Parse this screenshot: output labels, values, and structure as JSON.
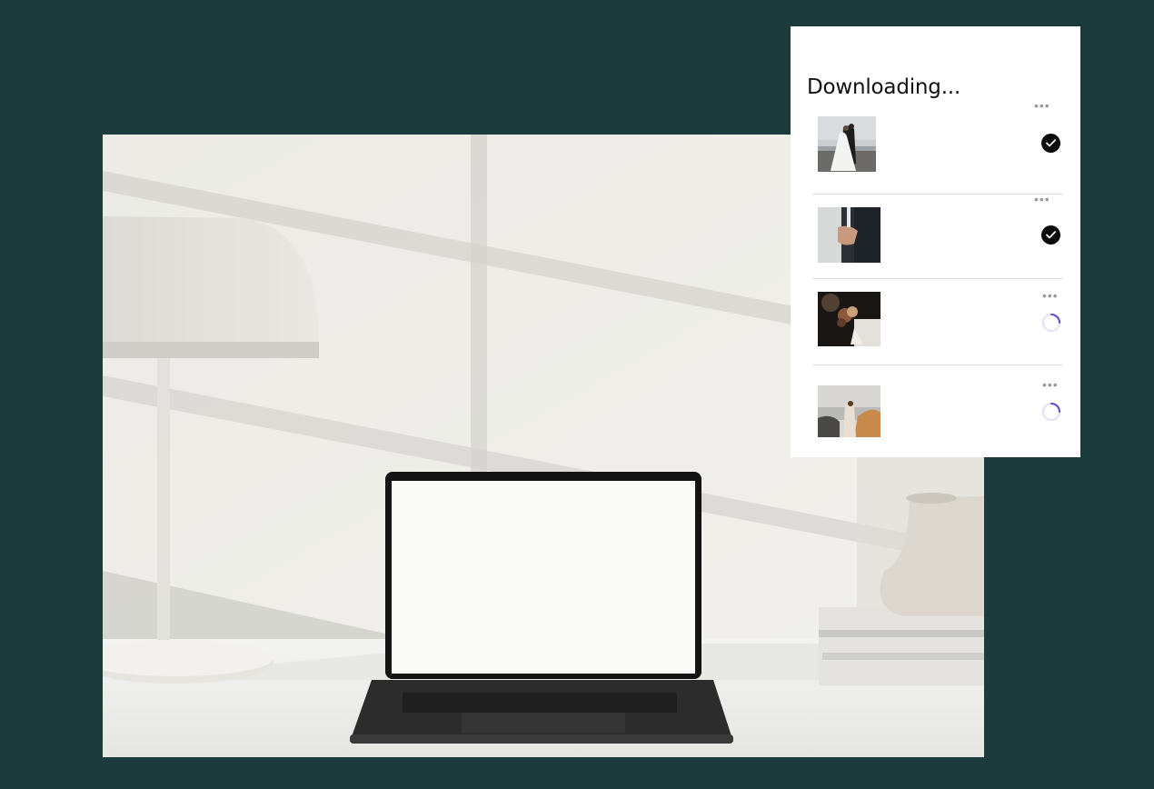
{
  "panel": {
    "title": "Downloading..."
  },
  "items": [
    {
      "thumbnail": "couple-on-beach-thumbnail",
      "status": "complete",
      "status_icon": "check-icon",
      "menu_icon": "more-dots-icon"
    },
    {
      "thumbnail": "holding-hands-thumbnail",
      "status": "complete",
      "status_icon": "check-icon",
      "menu_icon": "more-dots-icon"
    },
    {
      "thumbnail": "bouquet-thumbnail",
      "status": "loading",
      "status_icon": "spinner-icon",
      "menu_icon": "more-dots-icon"
    },
    {
      "thumbnail": "couple-on-rocks-thumbnail",
      "status": "loading",
      "status_icon": "spinner-icon",
      "menu_icon": "more-dots-icon"
    }
  ],
  "colors": {
    "background": "#1b3b3d",
    "panel": "#ffffff",
    "check": "#0b0b0b",
    "spinner_accent": "#5b4bd6"
  }
}
